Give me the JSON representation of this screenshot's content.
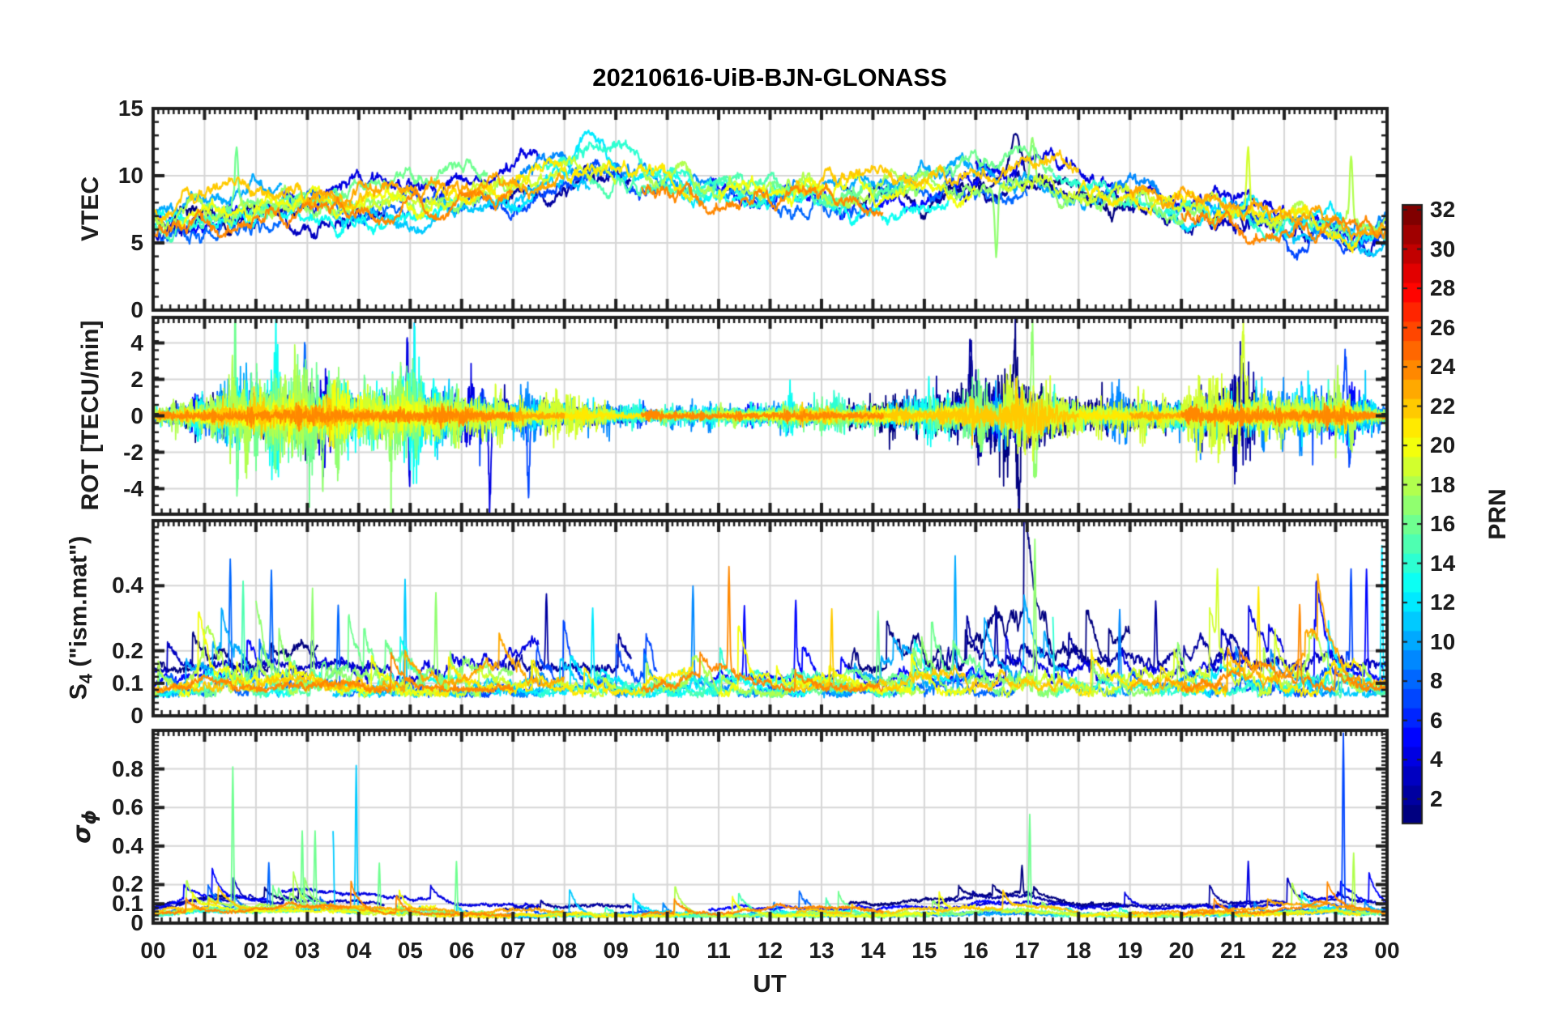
{
  "chart_data": {
    "type": "line",
    "title": "20210616-UiB-BJN-GLONASS",
    "xlabel": "UT",
    "x_range_hours": [
      0,
      24
    ],
    "x_tick_labels": [
      "00",
      "01",
      "02",
      "03",
      "04",
      "05",
      "06",
      "07",
      "08",
      "09",
      "10",
      "11",
      "12",
      "13",
      "14",
      "15",
      "16",
      "17",
      "18",
      "19",
      "20",
      "21",
      "22",
      "23",
      "00"
    ],
    "text_color": "#1c1c1c",
    "grid_color": "#d6d6d6",
    "frame_color": "#202020",
    "background": "#ffffff",
    "colorbar": {
      "label": "PRN",
      "colormap": "jet",
      "value_range": [
        1,
        32
      ],
      "tick_values": [
        2,
        4,
        6,
        8,
        10,
        12,
        14,
        16,
        18,
        20,
        22,
        24,
        26,
        28,
        30,
        32
      ]
    },
    "panels": [
      {
        "id": "vtec",
        "ylabel": "VTEC",
        "ylim": [
          0,
          15
        ],
        "ytick_values": [
          0,
          5,
          10,
          15
        ],
        "ytick_labels": [
          "0",
          "5",
          "10",
          "15"
        ],
        "y_minor_step": 1,
        "hourly_mean": [
          6.8,
          7.6,
          8.0,
          8.0,
          8.2,
          8.6,
          8.8,
          9.6,
          10.6,
          10.6,
          10.0,
          9.6,
          9.3,
          9.0,
          8.8,
          9.0,
          9.8,
          10.0,
          9.0,
          8.6,
          7.8,
          7.3,
          6.9,
          6.9
        ],
        "hourly_spread": [
          1.2,
          1.0,
          1.0,
          1.0,
          1.0,
          1.2,
          1.4,
          1.4,
          1.6,
          1.6,
          1.5,
          1.2,
          1.0,
          0.8,
          0.8,
          1.0,
          1.4,
          1.4,
          1.2,
          1.0,
          0.9,
          0.9,
          1.0,
          1.0
        ],
        "spikes": [
          {
            "t": 1.62,
            "v": 12.0,
            "prn": 16,
            "w": 0.04
          },
          {
            "t": 8.65,
            "v": 13.2,
            "prn": 12,
            "w": 0.45
          },
          {
            "t": 9.05,
            "v": 12.8,
            "prn": 14,
            "w": 0.6
          },
          {
            "t": 15.5,
            "v": 11.8,
            "prn": 8,
            "w": 0.15
          },
          {
            "t": 16.05,
            "v": 12.0,
            "prn": 2,
            "w": 0.12
          },
          {
            "t": 16.8,
            "v": 13.0,
            "prn": 1,
            "w": 0.15
          },
          {
            "t": 17.1,
            "v": 12.9,
            "prn": 17,
            "w": 0.06
          },
          {
            "t": 16.4,
            "v": 4.9,
            "prn": 17,
            "w": 0.04
          },
          {
            "t": 21.3,
            "v": 11.6,
            "prn": 19,
            "w": 0.04
          },
          {
            "t": 23.3,
            "v": 11.4,
            "prn": 18,
            "w": 0.04
          },
          {
            "t": 22.3,
            "v": 4.8,
            "prn": 7,
            "w": 0.25
          }
        ]
      },
      {
        "id": "rot",
        "ylabel": "ROT [TECU/min]",
        "ylim": [
          -5.4,
          5.4
        ],
        "ytick_values": [
          -4,
          -2,
          0,
          2,
          4
        ],
        "ytick_labels": [
          "-4",
          "-2",
          "0",
          "2",
          "4"
        ],
        "y_minor_step": 0.5,
        "hourly_sigma": [
          0.25,
          0.6,
          1.1,
          1.3,
          0.9,
          1.0,
          0.9,
          0.55,
          0.45,
          0.35,
          0.3,
          0.35,
          0.45,
          0.5,
          0.35,
          0.5,
          1.0,
          1.1,
          0.5,
          0.45,
          0.4,
          0.7,
          0.6,
          0.8
        ],
        "spikes": [
          {
            "t": 1.6,
            "v": 5.8,
            "prn": 16,
            "w": 0.02
          },
          {
            "t": 1.63,
            "v": -5.8,
            "prn": 16,
            "w": 0.02
          },
          {
            "t": 2.95,
            "v": 3.4,
            "prn": 8,
            "w": 0.03
          },
          {
            "t": 3.3,
            "v": -3.6,
            "prn": 17,
            "w": 0.03
          },
          {
            "t": 4.95,
            "v": 5.2,
            "prn": 4,
            "w": 0.025
          },
          {
            "t": 4.98,
            "v": -4.6,
            "prn": 4,
            "w": 0.025
          },
          {
            "t": 6.55,
            "v": -4.6,
            "prn": 4,
            "w": 0.03
          },
          {
            "t": 7.3,
            "v": -4.4,
            "prn": 7,
            "w": 0.03
          },
          {
            "t": 15.9,
            "v": 4.6,
            "prn": 2,
            "w": 0.03
          },
          {
            "t": 16.75,
            "v": 4.2,
            "prn": 1,
            "w": 0.03
          },
          {
            "t": 16.85,
            "v": -5.6,
            "prn": 1,
            "w": 0.03
          },
          {
            "t": 17.1,
            "v": 5.0,
            "prn": 17,
            "w": 0.035
          },
          {
            "t": 17.16,
            "v": -4.4,
            "prn": 17,
            "w": 0.03
          },
          {
            "t": 21.2,
            "v": 4.3,
            "prn": 19,
            "w": 0.04
          },
          {
            "t": 23.2,
            "v": 3.4,
            "prn": 7,
            "w": 0.05
          },
          {
            "t": 23.26,
            "v": -3.2,
            "prn": 7,
            "w": 0.04
          }
        ]
      },
      {
        "id": "s4",
        "ylabel_main": "S",
        "ylabel_sub": "4",
        "ylabel_rest": " (\"ism.mat\")",
        "ylim": [
          0,
          0.6
        ],
        "ytick_values": [
          0,
          0.1,
          0.2,
          0.4
        ],
        "ytick_labels": [
          "0",
          "0.1",
          "0.2",
          "0.4"
        ],
        "y_minor_step": 0.02,
        "hourly_activity": [
          0.5,
          1.2,
          1.0,
          0.9,
          0.8,
          1.0,
          0.8,
          0.9,
          0.8,
          0.9,
          1.0,
          1.1,
          1.0,
          1.0,
          0.8,
          1.2,
          1.1,
          1.3,
          0.9,
          1.0,
          0.9,
          1.0,
          1.1,
          1.2
        ],
        "spikes": [
          {
            "t": 1.5,
            "v": 0.42,
            "prn": 8
          },
          {
            "t": 1.75,
            "v": 0.37,
            "prn": 15
          },
          {
            "t": 2.3,
            "v": 0.33,
            "prn": 8
          },
          {
            "t": 3.1,
            "v": 0.36,
            "prn": 17
          },
          {
            "t": 3.6,
            "v": 0.33,
            "prn": 8
          },
          {
            "t": 4.9,
            "v": 0.41,
            "prn": 11
          },
          {
            "t": 5.5,
            "v": 0.3,
            "prn": 17
          },
          {
            "t": 7.65,
            "v": 0.37,
            "prn": 2
          },
          {
            "t": 8.55,
            "v": 0.28,
            "prn": 12
          },
          {
            "t": 9.4,
            "v": 0.33,
            "prn": 24
          },
          {
            "t": 10.5,
            "v": 0.36,
            "prn": 9
          },
          {
            "t": 11.2,
            "v": 0.38,
            "prn": 24
          },
          {
            "t": 11.5,
            "v": 0.3,
            "prn": 5
          },
          {
            "t": 12.5,
            "v": 0.33,
            "prn": 5
          },
          {
            "t": 13.2,
            "v": 0.3,
            "prn": 22
          },
          {
            "t": 14.1,
            "v": 0.28,
            "prn": 16
          },
          {
            "t": 15.6,
            "v": 0.47,
            "prn": 10
          },
          {
            "t": 16.4,
            "v": 0.3,
            "prn": 2
          },
          {
            "t": 17.15,
            "v": 0.52,
            "prn": 17
          },
          {
            "t": 17.5,
            "v": 0.29,
            "prn": 14
          },
          {
            "t": 18.8,
            "v": 0.3,
            "prn": 9
          },
          {
            "t": 19.5,
            "v": 0.33,
            "prn": 2
          },
          {
            "t": 20.7,
            "v": 0.27,
            "prn": 19
          },
          {
            "t": 21.5,
            "v": 0.32,
            "prn": 21
          },
          {
            "t": 22.3,
            "v": 0.3,
            "prn": 24
          },
          {
            "t": 23.3,
            "v": 0.36,
            "prn": 7
          },
          {
            "t": 23.6,
            "v": 0.41,
            "prn": 5
          },
          {
            "t": 23.9,
            "v": 0.5,
            "prn": 12
          }
        ]
      },
      {
        "id": "sigma_phi",
        "ylabel_main": "σ",
        "ylabel_sub": "ϕ",
        "ylim": [
          0,
          1.0
        ],
        "ytick_values": [
          0,
          0.1,
          0.2,
          0.4,
          0.6,
          0.8
        ],
        "ytick_labels": [
          "0",
          "0.1",
          "0.2",
          "0.4",
          "0.6",
          "0.8"
        ],
        "y_minor_step": 0.02,
        "hourly_activity": [
          0.6,
          1.4,
          1.2,
          1.3,
          1.0,
          0.8,
          0.5,
          0.4,
          0.5,
          0.6,
          0.6,
          0.6,
          0.6,
          0.6,
          0.5,
          0.6,
          0.9,
          1.0,
          0.5,
          0.5,
          0.5,
          0.6,
          0.8,
          1.1
        ],
        "spikes": [
          {
            "t": 1.55,
            "v": 0.8,
            "prn": 16
          },
          {
            "t": 2.25,
            "v": 0.3,
            "prn": 8
          },
          {
            "t": 2.9,
            "v": 0.45,
            "prn": 16
          },
          {
            "t": 3.15,
            "v": 0.46,
            "prn": 16
          },
          {
            "t": 3.5,
            "v": 0.47,
            "prn": 11
          },
          {
            "t": 3.95,
            "v": 0.8,
            "prn": 11
          },
          {
            "t": 4.4,
            "v": 0.3,
            "prn": 16
          },
          {
            "t": 5.9,
            "v": 0.31,
            "prn": 16
          },
          {
            "t": 16.9,
            "v": 0.28,
            "prn": 1
          },
          {
            "t": 17.05,
            "v": 0.55,
            "prn": 16
          },
          {
            "t": 21.3,
            "v": 0.31,
            "prn": 4
          },
          {
            "t": 23.15,
            "v": 0.97,
            "prn": 7
          },
          {
            "t": 23.35,
            "v": 0.35,
            "prn": 18
          }
        ]
      }
    ],
    "series": [
      {
        "prn": 1,
        "passes": [
          [
            0,
            3.2,
            1
          ],
          [
            13.5,
            19,
            1.7
          ]
        ]
      },
      {
        "prn": 2,
        "passes": [
          [
            6.8,
            9.3,
            1.2
          ],
          [
            15.2,
            21.5,
            1.5
          ]
        ]
      },
      {
        "prn": 3,
        "passes": [
          [
            0,
            4.5,
            0.8
          ],
          [
            20.5,
            24,
            1.2
          ]
        ]
      },
      {
        "prn": 4,
        "passes": [
          [
            2.5,
            7.5,
            1.6
          ],
          [
            16,
            22,
            1
          ]
        ]
      },
      {
        "prn": 5,
        "passes": [
          [
            0,
            2.2,
            1
          ],
          [
            10.8,
            16.5,
            0.8
          ],
          [
            22.5,
            24,
            1.3
          ]
        ]
      },
      {
        "prn": 7,
        "passes": [
          [
            4.8,
            9.8,
            1.4
          ],
          [
            21,
            24,
            1.5
          ]
        ]
      },
      {
        "prn": 8,
        "passes": [
          [
            0,
            5,
            1.3
          ],
          [
            11.5,
            17,
            1
          ]
        ]
      },
      {
        "prn": 9,
        "passes": [
          [
            7,
            12.5,
            0.9
          ],
          [
            18.5,
            24,
            1.1
          ]
        ]
      },
      {
        "prn": 10,
        "passes": [
          [
            0,
            2.5,
            1.2
          ],
          [
            13,
            18.5,
            1
          ]
        ]
      },
      {
        "prn": 11,
        "passes": [
          [
            3.5,
            8.5,
            1.2
          ],
          [
            22,
            24,
            1.2
          ]
        ]
      },
      {
        "prn": 12,
        "passes": [
          [
            6.5,
            11,
            1
          ],
          [
            19.5,
            24,
            1.3
          ]
        ]
      },
      {
        "prn": 13,
        "passes": [
          [
            0,
            6,
            1
          ],
          [
            10,
            15.5,
            0.8
          ]
        ]
      },
      {
        "prn": 14,
        "passes": [
          [
            7.5,
            13.5,
            0.9
          ],
          [
            17.5,
            23,
            0.9
          ]
        ]
      },
      {
        "prn": 15,
        "passes": [
          [
            0,
            4,
            1.1
          ],
          [
            8.5,
            14.5,
            0.8
          ],
          [
            23,
            24,
            1
          ]
        ]
      },
      {
        "prn": 16,
        "passes": [
          [
            1,
            6.5,
            1.5
          ],
          [
            12,
            17.5,
            1.2
          ]
        ]
      },
      {
        "prn": 17,
        "passes": [
          [
            2,
            7,
            1.7
          ],
          [
            14.5,
            20.5,
            1
          ]
        ]
      },
      {
        "prn": 18,
        "passes": [
          [
            0,
            3,
            1.5
          ],
          [
            9.5,
            15,
            0.8
          ],
          [
            21.5,
            24,
            1.4
          ]
        ]
      },
      {
        "prn": 19,
        "passes": [
          [
            4,
            9,
            1
          ],
          [
            16.5,
            22.5,
            1.4
          ]
        ]
      },
      {
        "prn": 20,
        "passes": [
          [
            0.5,
            5.5,
            1.2
          ],
          [
            11,
            16,
            1
          ]
        ]
      },
      {
        "prn": 21,
        "passes": [
          [
            5.5,
            10.5,
            0.8
          ],
          [
            18,
            23.5,
            1
          ]
        ]
      },
      {
        "prn": 22,
        "passes": [
          [
            0,
            4.2,
            0.9
          ],
          [
            12.5,
            18,
            1
          ]
        ]
      },
      {
        "prn": 23,
        "passes": [
          [
            3,
            8,
            1
          ],
          [
            19,
            24,
            1.1
          ]
        ]
      },
      {
        "prn": 24,
        "passes": [
          [
            0,
            7,
            0.5
          ],
          [
            9.5,
            14.2,
            0.7
          ],
          [
            20,
            24,
            0.8
          ]
        ]
      }
    ]
  }
}
